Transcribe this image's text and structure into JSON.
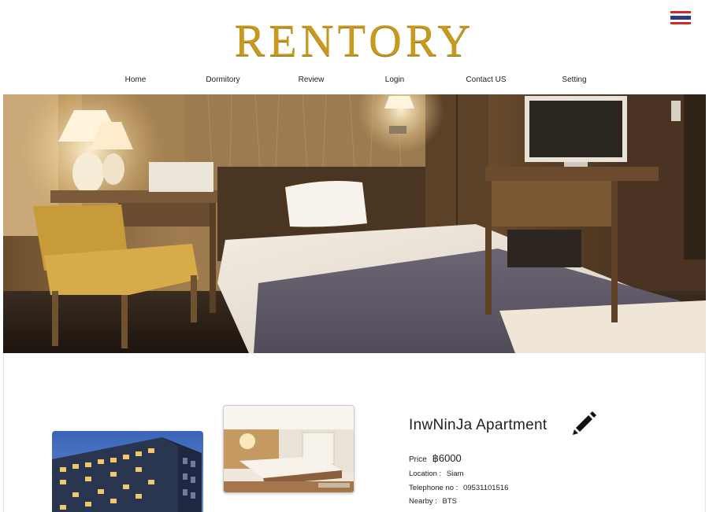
{
  "header": {
    "logo": "RENTORY",
    "language_flag": "thai-flag-icon"
  },
  "nav": {
    "items": [
      {
        "label": "Home"
      },
      {
        "label": "Dormitory"
      },
      {
        "label": "Review"
      },
      {
        "label": "Login"
      },
      {
        "label": "Contact US"
      },
      {
        "label": "Setting"
      }
    ]
  },
  "hero": {
    "image": "hotel-room-photo"
  },
  "listing": {
    "name": "InwNinJa  Apartment",
    "price_label": "Price",
    "price_value": "฿6000",
    "location_label": "Location :",
    "location_value": "Siam",
    "telephone_label": "Telephone no :",
    "telephone_value": "09531101516",
    "nearby_label": "Nearby :",
    "nearby_value": "BTS",
    "edit_icon": "pencil-icon",
    "images": [
      "building-photo",
      "room-photo"
    ]
  },
  "colors": {
    "logo_gold": "#c79a1e",
    "text": "#222222",
    "background": "#ffffff"
  }
}
